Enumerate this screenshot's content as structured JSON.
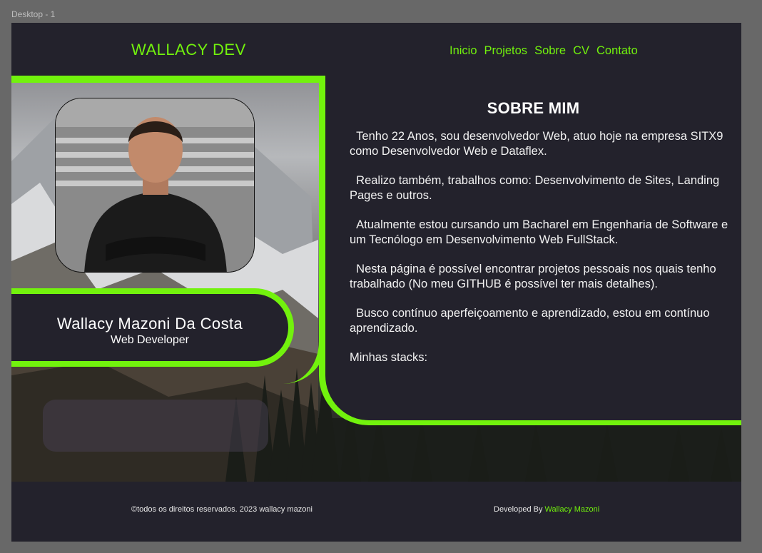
{
  "canvas": {
    "label": "Desktop - 1"
  },
  "header": {
    "brand": "WALLACY DEV",
    "nav": [
      "Inicio",
      "Projetos",
      "Sobre",
      "CV",
      "Contato"
    ]
  },
  "profile": {
    "name": "Wallacy Mazoni Da Costa",
    "role": "Web Developer"
  },
  "about": {
    "title": "SOBRE MIM",
    "paragraphs": [
      "  Tenho 22 Anos, sou desenvolvedor Web, atuo hoje na empresa SITX9 como Desenvolvedor Web e Dataflex.",
      "  Realizo também, trabalhos como: Desenvolvimento de Sites, Landing Pages e outros.",
      "  Atualmente estou cursando um Bacharel em Engenharia de Software e um Tecnólogo em Desenvolvimento Web FullStack.",
      "  Nesta página é possível encontrar projetos pessoais nos quais tenho trabalhado (No meu GITHUB é possível ter mais detalhes).",
      "  Busco contínuo aperfeiçoamento e aprendizado, estou em contínuo aprendizado.",
      "Minhas stacks:"
    ]
  },
  "footer": {
    "copyright": "©todos os direitos reservados. 2023 wallacy mazoni",
    "developed_by_prefix": "Developed By ",
    "developed_by_name": "Wallacy Mazoni"
  },
  "colors": {
    "accent": "#72f20d",
    "background": "#23222c",
    "canvas": "#686868"
  }
}
